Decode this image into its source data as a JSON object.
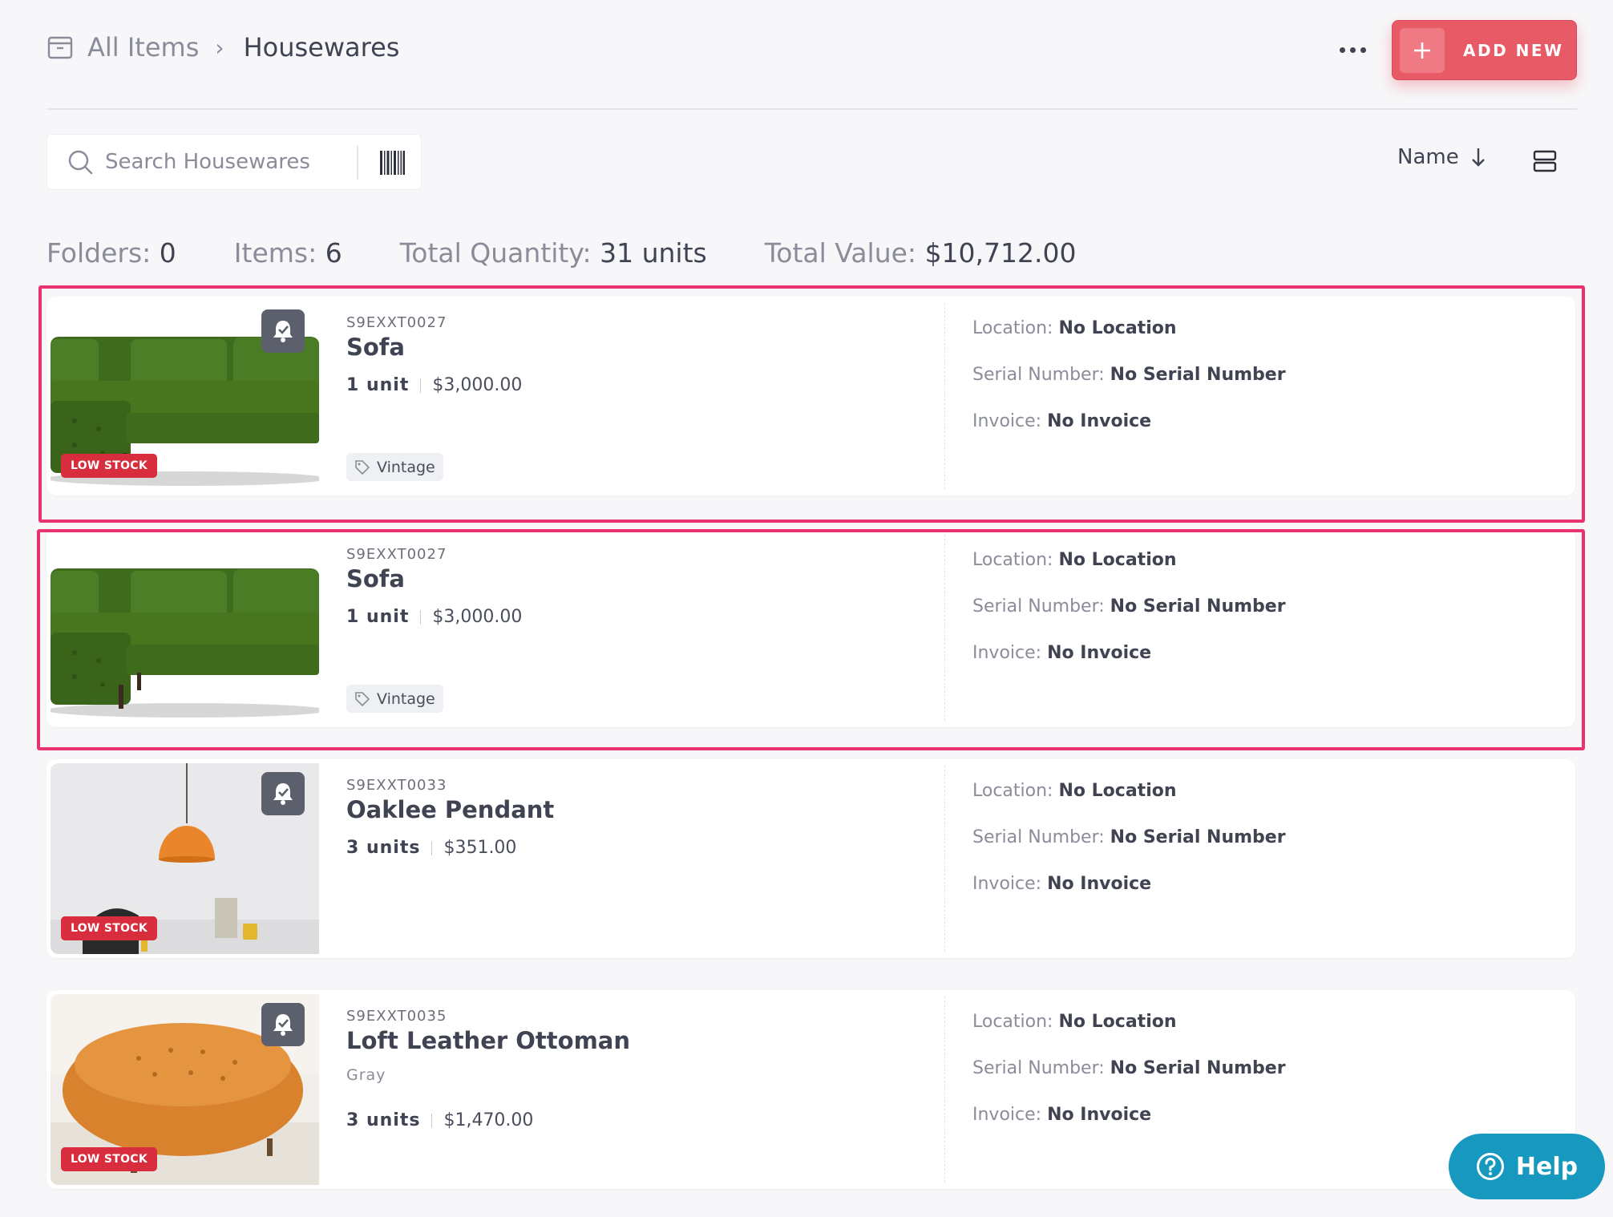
{
  "breadcrumb": {
    "root": "All Items",
    "separator": "›",
    "current": "Housewares"
  },
  "header": {
    "more_icon": "more-dots-icon",
    "add_label": "ADD NEW"
  },
  "search": {
    "placeholder": "Search Housewares",
    "value": ""
  },
  "sort": {
    "label": "Name",
    "direction": "descending"
  },
  "summary": {
    "folders_label": "Folders:",
    "folders": "0",
    "items_label": "Items:",
    "items": "6",
    "quantity_label": "Total Quantity:",
    "quantity": "31 units",
    "value_label": "Total Value:",
    "value": "$10,712.00"
  },
  "labels": {
    "location": "Location:",
    "serial": "Serial Number:",
    "invoice": "Invoice:",
    "low_stock": "LOW STOCK"
  },
  "items": [
    {
      "sku": "S9EXXT0027",
      "name": "Sofa",
      "units": "1 unit",
      "price": "$3,000.00",
      "tag": "Vintage",
      "location": "No Location",
      "serial": "No Serial Number",
      "invoice": "No Invoice",
      "low_stock": true,
      "alert": true,
      "image": "green-sofa"
    },
    {
      "sku": "S9EXXT0027",
      "name": "Sofa",
      "units": "1 unit",
      "price": "$3,000.00",
      "tag": "Vintage",
      "location": "No Location",
      "serial": "No Serial Number",
      "invoice": "No Invoice",
      "low_stock": false,
      "alert": false,
      "image": "green-sofa"
    },
    {
      "sku": "S9EXXT0033",
      "name": "Oaklee Pendant",
      "units": "3 units",
      "price": "$351.00",
      "location": "No Location",
      "serial": "No Serial Number",
      "invoice": "No Invoice",
      "low_stock": true,
      "alert": true,
      "image": "orange-pendant-lamp"
    },
    {
      "sku": "S9EXXT0035",
      "name": "Loft Leather Ottoman",
      "variant": "Gray",
      "units": "3 units",
      "price": "$1,470.00",
      "location": "No Location",
      "serial": "No Serial Number",
      "invoice": "No Invoice",
      "low_stock": true,
      "alert": true,
      "image": "leather-ottoman"
    }
  ],
  "help": {
    "label": "Help"
  },
  "colors": {
    "accent": "#e85a66",
    "low_stock": "#d72d3c",
    "highlight": "#e8336e",
    "help": "#1799bf"
  }
}
